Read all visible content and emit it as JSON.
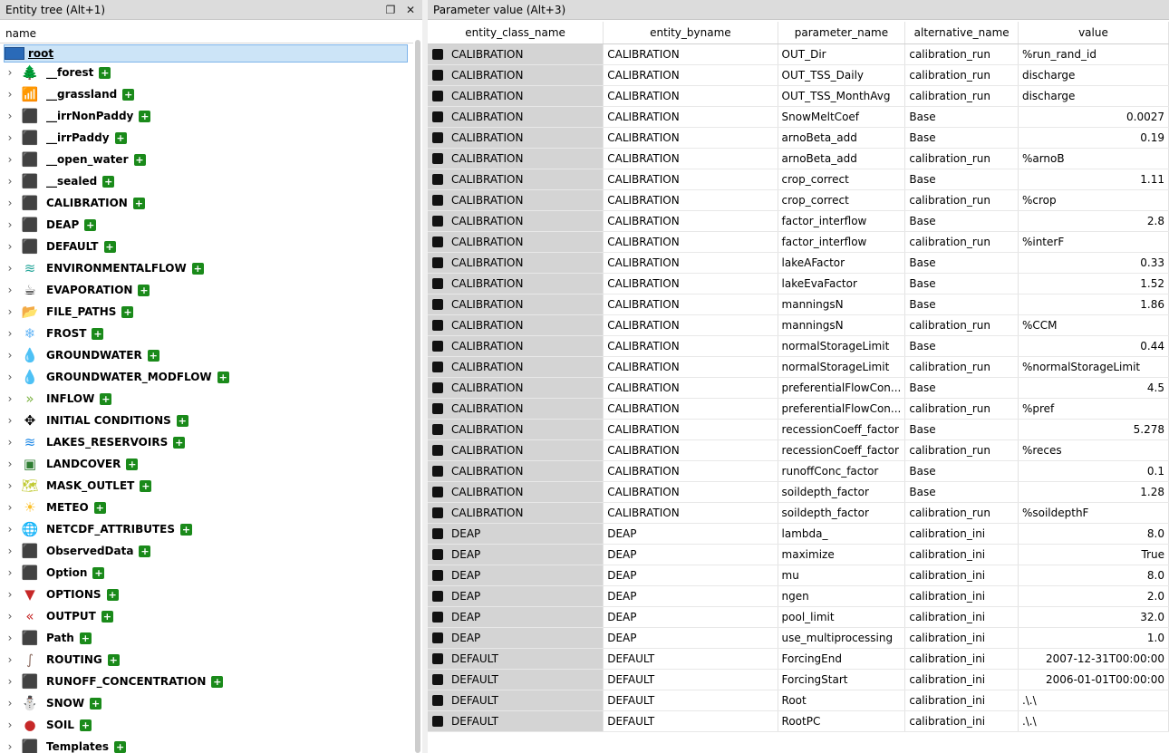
{
  "left_pane": {
    "title": "Entity tree (Alt+1)",
    "column_header": "name",
    "root_label": "root",
    "items": [
      {
        "label": "__forest",
        "icon": "tree-icon",
        "glyph": "🌲",
        "color": "#1b5e20"
      },
      {
        "label": "__grassland",
        "icon": "signal-bars-icon",
        "glyph": "📶",
        "color": "#8bc34a"
      },
      {
        "label": "__irrNonPaddy",
        "icon": "cube-icon",
        "glyph": "⬛",
        "color": "#000000"
      },
      {
        "label": "__irrPaddy",
        "icon": "cube-icon",
        "glyph": "⬛",
        "color": "#000000"
      },
      {
        "label": "__open_water",
        "icon": "cube-icon",
        "glyph": "⬛",
        "color": "#000000"
      },
      {
        "label": "__sealed",
        "icon": "cube-icon",
        "glyph": "⬛",
        "color": "#000000"
      },
      {
        "label": "CALIBRATION",
        "icon": "cube-icon",
        "glyph": "⬛",
        "color": "#000000"
      },
      {
        "label": "DEAP",
        "icon": "cube-icon",
        "glyph": "⬛",
        "color": "#000000"
      },
      {
        "label": "DEFAULT",
        "icon": "cube-icon",
        "glyph": "⬛",
        "color": "#000000"
      },
      {
        "label": "ENVIRONMENTALFLOW",
        "icon": "water-waves-icon",
        "glyph": "≋",
        "color": "#26a69a"
      },
      {
        "label": "EVAPORATION",
        "icon": "coffee-cup-icon",
        "glyph": "☕",
        "color": "#000000"
      },
      {
        "label": "FILE_PATHS",
        "icon": "folder-icon",
        "glyph": "📂",
        "color": "#f9a825"
      },
      {
        "label": "FROST",
        "icon": "snowflake-icon",
        "glyph": "❄",
        "color": "#64b5f6"
      },
      {
        "label": "GROUNDWATER",
        "icon": "droplet-icon",
        "glyph": "💧",
        "color": "#1565c0"
      },
      {
        "label": "GROUNDWATER_MODFLOW",
        "icon": "droplet-icon",
        "glyph": "💧",
        "color": "#1565c0"
      },
      {
        "label": "INFLOW",
        "icon": "double-chevron-right-icon",
        "glyph": "»",
        "color": "#7cb342"
      },
      {
        "label": "INITIAL CONDITIONS",
        "icon": "compress-arrows-icon",
        "glyph": "✥",
        "color": "#000000"
      },
      {
        "label": "LAKES_RESERVOIRS",
        "icon": "water-waves-icon",
        "glyph": "≋",
        "color": "#1e88e5"
      },
      {
        "label": "LANDCOVER",
        "icon": "landscape-image-icon",
        "glyph": "▣",
        "color": "#2e7d32"
      },
      {
        "label": "MASK_OUTLET",
        "icon": "map-icon",
        "glyph": "🗺",
        "color": "#c0ca33"
      },
      {
        "label": "METEO",
        "icon": "sun-icon",
        "glyph": "☀",
        "color": "#fbc02d"
      },
      {
        "label": "NETCDF_ATTRIBUTES",
        "icon": "globe-icon",
        "glyph": "🌐",
        "color": "#1976d2"
      },
      {
        "label": "ObservedData",
        "icon": "cube-icon",
        "glyph": "⬛",
        "color": "#000000"
      },
      {
        "label": "Option",
        "icon": "cube-icon",
        "glyph": "⬛",
        "color": "#000000"
      },
      {
        "label": "OPTIONS",
        "icon": "filter-icon",
        "glyph": "▼",
        "color": "#c62828"
      },
      {
        "label": "OUTPUT",
        "icon": "double-chevron-left-icon",
        "glyph": "«",
        "color": "#c62828"
      },
      {
        "label": "Path",
        "icon": "cube-icon",
        "glyph": "⬛",
        "color": "#000000"
      },
      {
        "label": "ROUTING",
        "icon": "road-icon",
        "glyph": "∫",
        "color": "#8d6e63"
      },
      {
        "label": "RUNOFF_CONCENTRATION",
        "icon": "cube-icon",
        "glyph": "⬛",
        "color": "#000000"
      },
      {
        "label": "SNOW",
        "icon": "igloo-icon",
        "glyph": "⛄",
        "color": "#29b6f6"
      },
      {
        "label": "SOIL",
        "icon": "soil-globe-icon",
        "glyph": "●",
        "color": "#c62828"
      },
      {
        "label": "Templates",
        "icon": "cube-icon",
        "glyph": "⬛",
        "color": "#000000"
      }
    ]
  },
  "right_pane": {
    "title": "Parameter value (Alt+3)",
    "columns": [
      "entity_class_name",
      "entity_byname",
      "parameter_name",
      "alternative_name",
      "value"
    ],
    "rows": [
      [
        "CALIBRATION",
        "CALIBRATION",
        "OUT_Dir",
        "calibration_run",
        "%run_rand_id"
      ],
      [
        "CALIBRATION",
        "CALIBRATION",
        "OUT_TSS_Daily",
        "calibration_run",
        "discharge"
      ],
      [
        "CALIBRATION",
        "CALIBRATION",
        "OUT_TSS_MonthAvg",
        "calibration_run",
        "discharge"
      ],
      [
        "CALIBRATION",
        "CALIBRATION",
        "SnowMeltCoef",
        "Base",
        "0.0027"
      ],
      [
        "CALIBRATION",
        "CALIBRATION",
        "arnoBeta_add",
        "Base",
        "0.19"
      ],
      [
        "CALIBRATION",
        "CALIBRATION",
        "arnoBeta_add",
        "calibration_run",
        "%arnoB"
      ],
      [
        "CALIBRATION",
        "CALIBRATION",
        "crop_correct",
        "Base",
        "1.11"
      ],
      [
        "CALIBRATION",
        "CALIBRATION",
        "crop_correct",
        "calibration_run",
        "%crop"
      ],
      [
        "CALIBRATION",
        "CALIBRATION",
        "factor_interflow",
        "Base",
        "2.8"
      ],
      [
        "CALIBRATION",
        "CALIBRATION",
        "factor_interflow",
        "calibration_run",
        "%interF"
      ],
      [
        "CALIBRATION",
        "CALIBRATION",
        "lakeAFactor",
        "Base",
        "0.33"
      ],
      [
        "CALIBRATION",
        "CALIBRATION",
        "lakeEvaFactor",
        "Base",
        "1.52"
      ],
      [
        "CALIBRATION",
        "CALIBRATION",
        "manningsN",
        "Base",
        "1.86"
      ],
      [
        "CALIBRATION",
        "CALIBRATION",
        "manningsN",
        "calibration_run",
        "%CCM"
      ],
      [
        "CALIBRATION",
        "CALIBRATION",
        "normalStorageLimit",
        "Base",
        "0.44"
      ],
      [
        "CALIBRATION",
        "CALIBRATION",
        "normalStorageLimit",
        "calibration_run",
        "%normalStorageLimit"
      ],
      [
        "CALIBRATION",
        "CALIBRATION",
        "preferentialFlowCon...",
        "Base",
        "4.5"
      ],
      [
        "CALIBRATION",
        "CALIBRATION",
        "preferentialFlowCon...",
        "calibration_run",
        "%pref"
      ],
      [
        "CALIBRATION",
        "CALIBRATION",
        "recessionCoeff_factor",
        "Base",
        "5.278"
      ],
      [
        "CALIBRATION",
        "CALIBRATION",
        "recessionCoeff_factor",
        "calibration_run",
        "%reces"
      ],
      [
        "CALIBRATION",
        "CALIBRATION",
        "runoffConc_factor",
        "Base",
        "0.1"
      ],
      [
        "CALIBRATION",
        "CALIBRATION",
        "soildepth_factor",
        "Base",
        "1.28"
      ],
      [
        "CALIBRATION",
        "CALIBRATION",
        "soildepth_factor",
        "calibration_run",
        "%soildepthF"
      ],
      [
        "DEAP",
        "DEAP",
        "lambda_",
        "calibration_ini",
        "8.0"
      ],
      [
        "DEAP",
        "DEAP",
        "maximize",
        "calibration_ini",
        "True"
      ],
      [
        "DEAP",
        "DEAP",
        "mu",
        "calibration_ini",
        "8.0"
      ],
      [
        "DEAP",
        "DEAP",
        "ngen",
        "calibration_ini",
        "2.0"
      ],
      [
        "DEAP",
        "DEAP",
        "pool_limit",
        "calibration_ini",
        "32.0"
      ],
      [
        "DEAP",
        "DEAP",
        "use_multiprocessing",
        "calibration_ini",
        "1.0"
      ],
      [
        "DEFAULT",
        "DEFAULT",
        "ForcingEnd",
        "calibration_ini",
        "2007-12-31T00:00:00"
      ],
      [
        "DEFAULT",
        "DEFAULT",
        "ForcingStart",
        "calibration_ini",
        "2006-01-01T00:00:00"
      ],
      [
        "DEFAULT",
        "DEFAULT",
        "Root",
        "calibration_ini",
        ".\\.\\"
      ],
      [
        "DEFAULT",
        "DEFAULT",
        "RootPC",
        "calibration_ini",
        ".\\.\\"
      ]
    ],
    "right_aligned_values": [
      "0.0027",
      "0.19",
      "1.11",
      "2.8",
      "0.33",
      "1.52",
      "1.86",
      "0.44",
      "4.5",
      "5.278",
      "0.1",
      "1.28",
      "8.0",
      "True",
      "2.0",
      "32.0",
      "1.0",
      "2007-12-31T00:00:00",
      "2006-01-01T00:00:00"
    ]
  },
  "colors": {
    "selection": "#cce4f7",
    "add_icon": "#1a8a1a",
    "class_cell": "#d4d4d4"
  }
}
